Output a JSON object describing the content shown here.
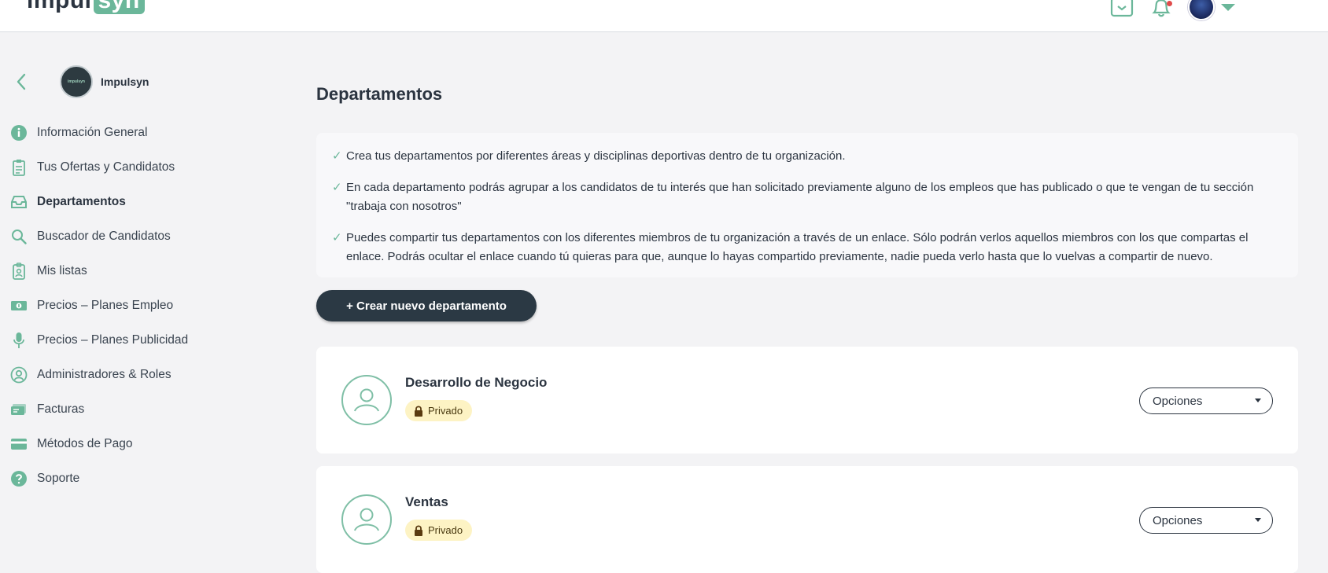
{
  "brand": {
    "logo_part1": "impul",
    "logo_part2": "syn"
  },
  "topbar": {
    "icons": [
      "briefcase-icon",
      "bell-icon",
      "user-avatar"
    ],
    "notification_color": "#e04b4b"
  },
  "sidebar": {
    "org_name": "Impulsyn",
    "org_avatar_text": "impulsyn",
    "items": [
      {
        "label": "Información General",
        "icon": "info-icon"
      },
      {
        "label": "Tus Ofertas y Candidatos",
        "icon": "clipboard-icon"
      },
      {
        "label": "Departamentos",
        "icon": "inbox-icon",
        "active": true
      },
      {
        "label": "Buscador de Candidatos",
        "icon": "search-icon"
      },
      {
        "label": "Mis listas",
        "icon": "badge-list-icon"
      },
      {
        "label": "Precios – Planes Empleo",
        "icon": "money-icon"
      },
      {
        "label": "Precios – Planes Publicidad",
        "icon": "microphone-icon"
      },
      {
        "label": "Administradores & Roles",
        "icon": "user-circle-icon"
      },
      {
        "label": "Facturas",
        "icon": "invoice-icon"
      },
      {
        "label": "Métodos de Pago",
        "icon": "credit-card-icon"
      },
      {
        "label": "Soporte",
        "icon": "help-icon"
      }
    ]
  },
  "main": {
    "title": "Departamentos",
    "info": [
      "Crea tus departamentos por diferentes áreas y disciplinas deportivas dentro de tu organización.",
      "En cada departamento podrás agrupar a los candidatos de tu interés que han solicitado previamente alguno de los empleos que has publicado o que te vengan de tu sección \"trabaja con nosotros\"",
      "Puedes compartir tus departamentos con los diferentes miembros de tu organización a través de un enlace. Sólo podrán verlos aquellos miembros con los que compartas el enlace. Podrás ocultar el enlace cuando tú quieras para que, aunque lo hayas compartido previamente, nadie pueda verlo hasta que lo vuelvas a compartir de nuevo."
    ],
    "create_button": "+ Crear nuevo departamento",
    "departments": [
      {
        "name": "Desarrollo de Negocio",
        "badge": "Privado",
        "options_label": "Opciones"
      },
      {
        "name": "Ventas",
        "badge": "Privado",
        "options_label": "Opciones"
      }
    ]
  },
  "colors": {
    "accent": "#6bb79a",
    "dark": "#2b3944",
    "badge_bg": "#fdf3c4",
    "background": "#f3f3f5"
  }
}
